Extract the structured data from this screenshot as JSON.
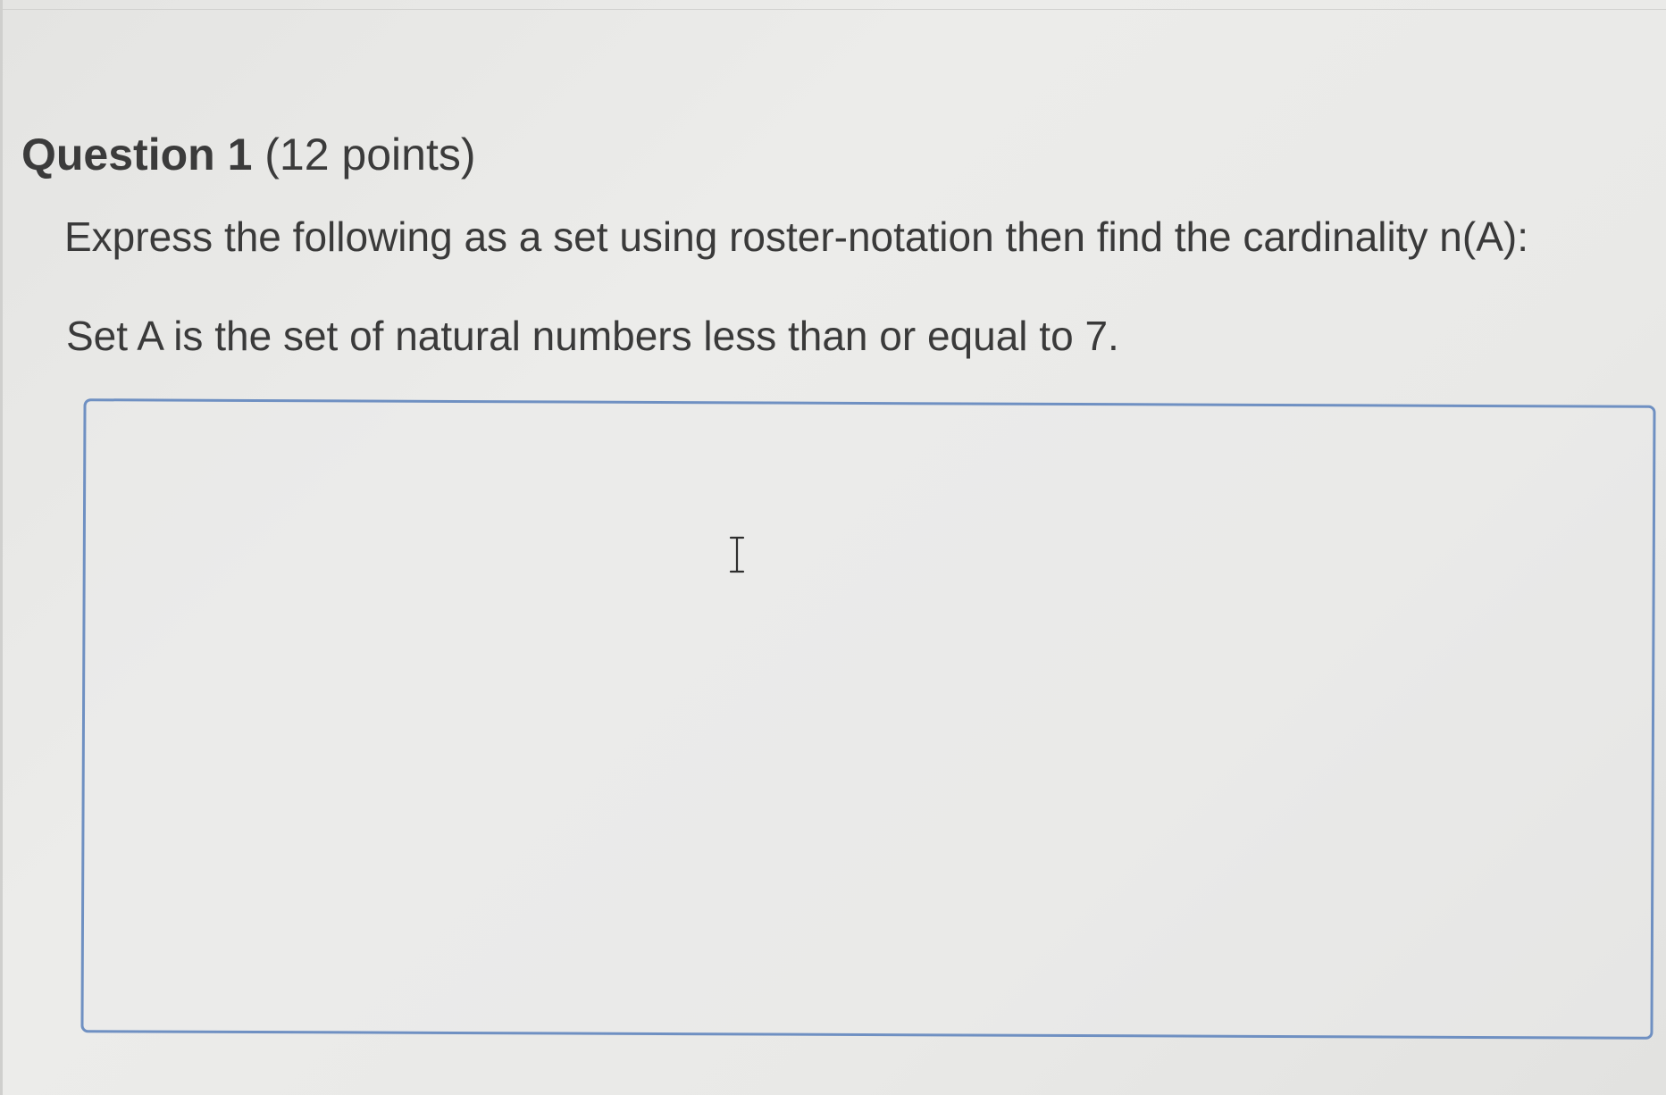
{
  "question": {
    "label": "Question 1",
    "points": " (12 points)"
  },
  "prompt": "Express the following as a set using roster-notation then find the cardinality n(A):",
  "set_description": "Set A is the set of natural numbers less than or equal to 7.",
  "answer": {
    "value": ""
  },
  "icons": {
    "cursor": "text-cursor-icon"
  },
  "colors": {
    "answer_border": "#6f90c2",
    "text": "#3a3a3a"
  }
}
